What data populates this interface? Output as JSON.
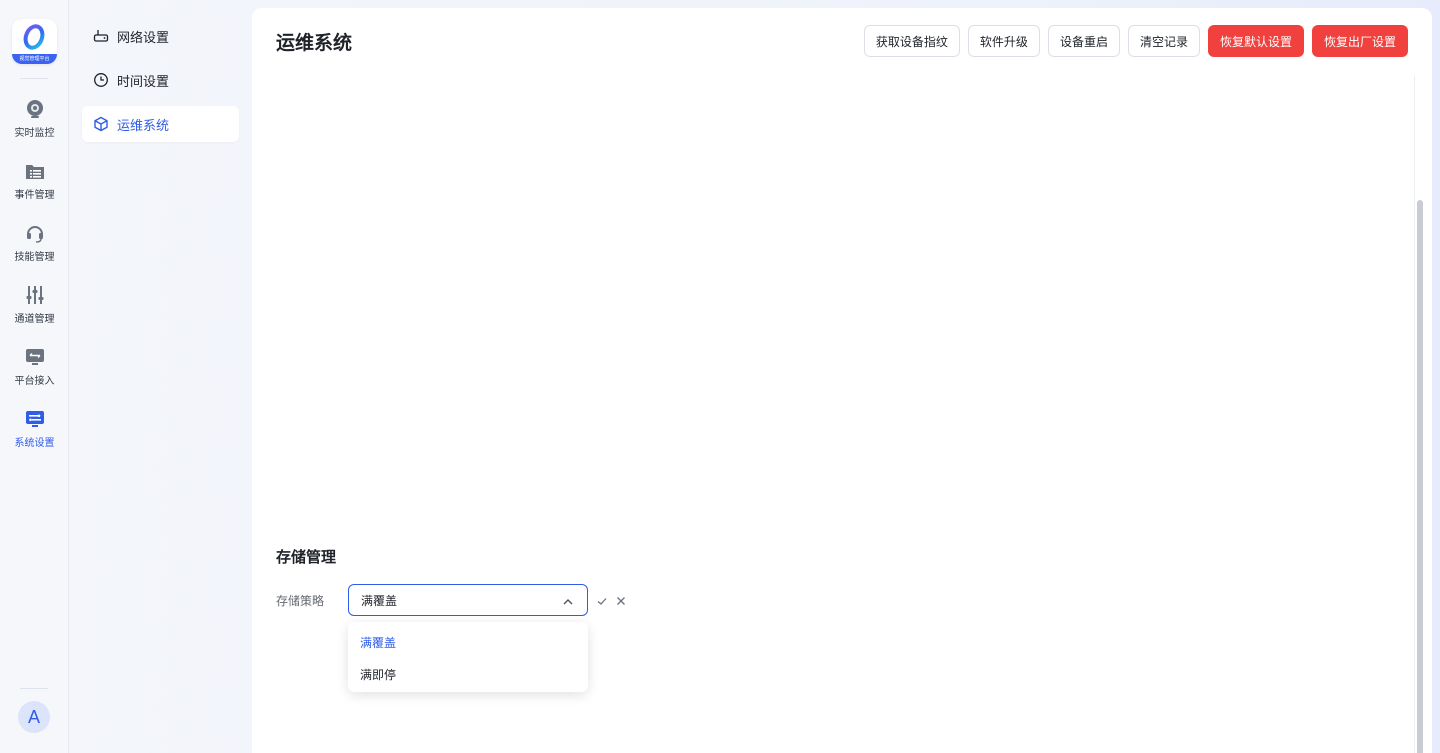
{
  "brand": {
    "logo_caption": "视觉管理平台",
    "accent_color": "#2f5ce8",
    "danger_color": "#f0413f"
  },
  "rail": {
    "items": [
      {
        "label": "实时监控",
        "icon": "camera-icon"
      },
      {
        "label": "事件管理",
        "icon": "folder-list-icon"
      },
      {
        "label": "技能管理",
        "icon": "headset-icon"
      },
      {
        "label": "通道管理",
        "icon": "sliders-icon"
      },
      {
        "label": "平台接入",
        "icon": "platform-access-icon"
      },
      {
        "label": "系统设置",
        "icon": "system-settings-icon",
        "active": true
      }
    ],
    "avatar": "A"
  },
  "submenu": {
    "items": [
      {
        "label": "网络设置",
        "icon": "router-icon"
      },
      {
        "label": "时间设置",
        "icon": "clock-icon"
      },
      {
        "label": "运维系统",
        "icon": "cube-icon",
        "active": true
      }
    ]
  },
  "main": {
    "title": "运维系统",
    "toolbar": {
      "fingerprint": "获取设备指纹",
      "upgrade": "软件升级",
      "reboot": "设备重启",
      "clear_logs": "清空记录",
      "restore_defaults": "恢复默认设置",
      "factory_reset": "恢复出厂设置"
    },
    "storage": {
      "section_title": "存储管理",
      "policy_label": "存储策略",
      "policy_value": "满覆盖",
      "options": [
        "满覆盖",
        "满即停"
      ],
      "selected_index": 0
    }
  }
}
